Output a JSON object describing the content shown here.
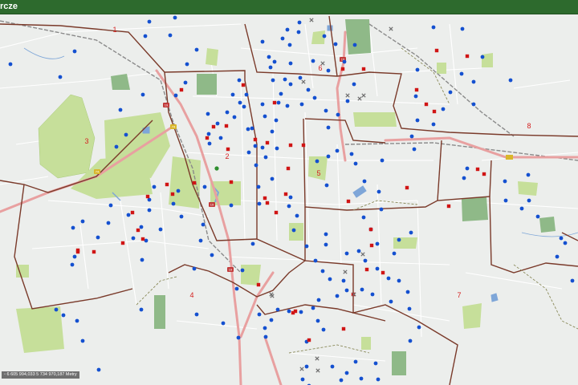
{
  "header": {
    "title": "rcze"
  },
  "districts": [
    {
      "id": "district-1",
      "label": "1"
    },
    {
      "id": "district-2",
      "label": "2"
    },
    {
      "id": "district-3",
      "label": "3"
    },
    {
      "id": "district-4",
      "label": "4"
    },
    {
      "id": "district-5",
      "label": "5"
    },
    {
      "id": "district-6",
      "label": "6"
    },
    {
      "id": "district-7",
      "label": "7"
    },
    {
      "id": "district-8",
      "label": "8"
    }
  ],
  "road_shields": [
    "19",
    "74",
    "19",
    "74",
    "19",
    "19"
  ],
  "coordinates_readout": "◦ 6 605 994,033 5 734 970,187 Metry",
  "colors": {
    "header": "#2d6a2d",
    "background": "#eceeec",
    "green_area": "#c6df9a",
    "dark_green_area": "#8fb988",
    "water": "#7ea6d8",
    "main_road": "#e8a0a0",
    "district_boundary": "#7a3a2a",
    "railway": "#8a8a8a",
    "marker_blue": "#1450d0",
    "marker_red": "#d01515",
    "marker_green": "#2f8f2f",
    "marker_gray": "#6f6f6f"
  },
  "marker_legend": {
    "blue": "circle-marker",
    "red": "square-marker",
    "gray": "x-marker"
  }
}
